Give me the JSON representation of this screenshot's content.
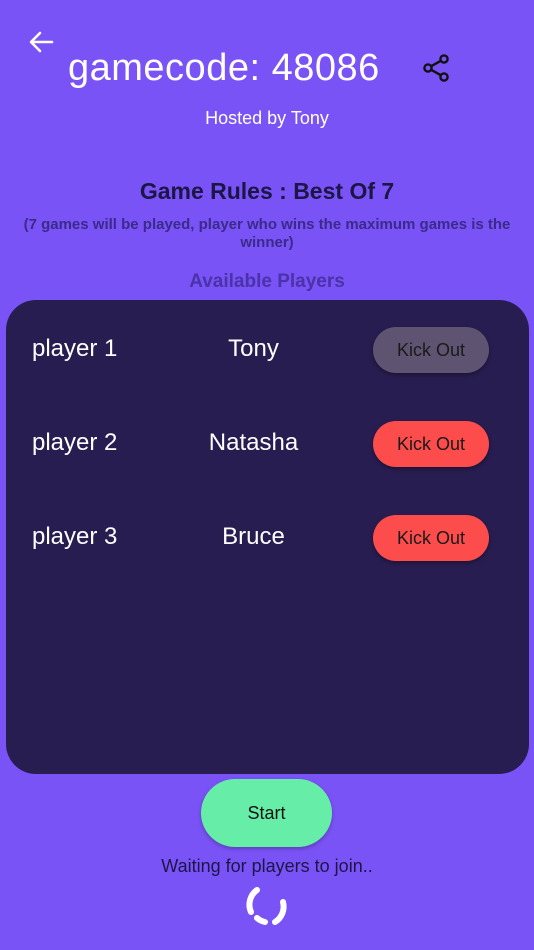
{
  "header": {
    "back_icon": "back-arrow-icon",
    "title": "gamecode: 48086",
    "share_icon": "share-icon",
    "hosted_by": "Hosted by Tony"
  },
  "rules": {
    "title": "Game Rules : Best Of 7",
    "description": "(7 games will be played, player who wins the maximum games is the winner)"
  },
  "players_section": {
    "heading": "Available Players",
    "players": [
      {
        "slot": "player 1",
        "name": "Tony",
        "action": "Kick Out",
        "enabled": false
      },
      {
        "slot": "player 2",
        "name": "Natasha",
        "action": "Kick Out",
        "enabled": true
      },
      {
        "slot": "player 3",
        "name": "Bruce",
        "action": "Kick Out",
        "enabled": true
      }
    ]
  },
  "footer": {
    "start_label": "Start",
    "status": "Waiting for players to join..",
    "spinner_icon": "loading-spinner-icon"
  },
  "colors": {
    "background": "#7a53f7",
    "panel": "#281d50",
    "kick_active": "#fc4c4c",
    "kick_disabled": "#5e5472",
    "start": "#66eea8"
  }
}
